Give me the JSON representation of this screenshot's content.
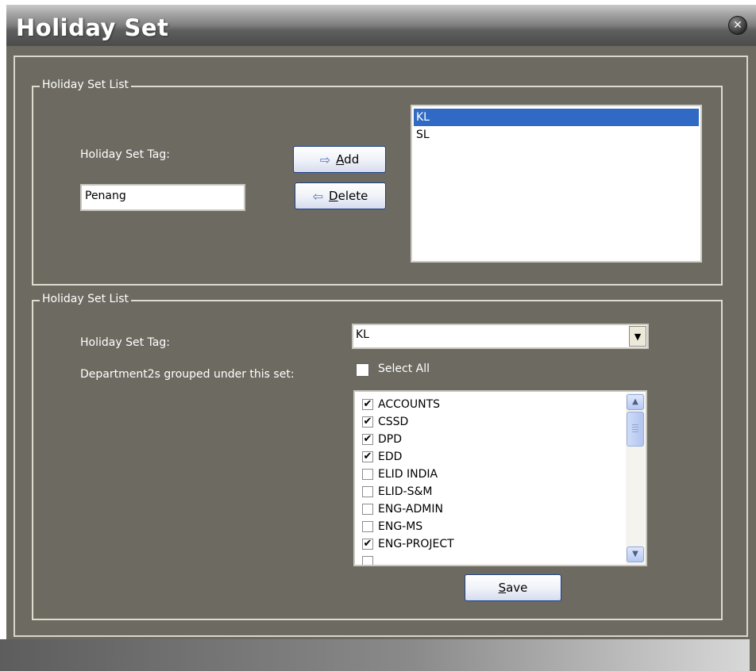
{
  "window": {
    "title": "Holiday Set",
    "close_icon": "close-icon"
  },
  "top_group": {
    "legend": "Holiday Set List",
    "tag_label": "Holiday Set Tag:",
    "tag_value": "Penang",
    "add_button": {
      "icon": "arrow-right-icon",
      "mnemonic": "A",
      "rest": "dd"
    },
    "delete_button": {
      "icon": "arrow-left-icon",
      "mnemonic": "D",
      "rest": "elete"
    },
    "list_items": [
      "KL",
      "SL"
    ],
    "selected_item": "KL"
  },
  "bottom_group": {
    "legend": "Holiday Set List",
    "tag_label": "Holiday Set Tag:",
    "tag_select_value": "KL",
    "departments_label": "Department2s grouped under this set:",
    "select_all_label": "Select All",
    "select_all_checked": false,
    "departments": [
      {
        "name": "ACCOUNTS",
        "checked": true
      },
      {
        "name": "CSSD",
        "checked": true
      },
      {
        "name": "DPD",
        "checked": true
      },
      {
        "name": "EDD",
        "checked": true
      },
      {
        "name": "ELID INDIA",
        "checked": false
      },
      {
        "name": "ELID-S&M",
        "checked": false
      },
      {
        "name": "ENG-ADMIN",
        "checked": false
      },
      {
        "name": "ENG-MS",
        "checked": false
      },
      {
        "name": "ENG-PROJECT",
        "checked": true
      }
    ],
    "save_button": {
      "mnemonic": "S",
      "rest": "ave"
    }
  },
  "colors": {
    "background": "#6d6b61",
    "selection": "#316ac5",
    "button_border": "#1b3f8a"
  }
}
